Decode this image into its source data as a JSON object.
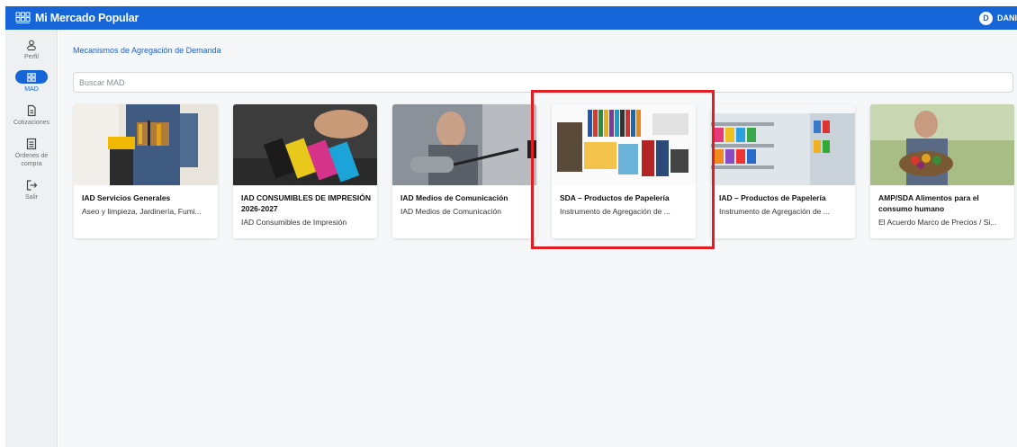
{
  "app": {
    "title": "Mi Mercado Popular"
  },
  "user": {
    "initial": "D",
    "name": "DANI"
  },
  "sidebar": {
    "items": [
      {
        "label": "Perfil",
        "icon": "user-group-icon"
      },
      {
        "label": "MAD",
        "icon": "grid-icon",
        "active": true
      },
      {
        "label": "Cotizaciones",
        "icon": "document-icon"
      },
      {
        "label": "Órdenes de compra",
        "icon": "list-icon"
      },
      {
        "label": "Salir",
        "icon": "logout-icon"
      }
    ]
  },
  "main": {
    "breadcrumb": "Mecanismos de Agregación de Demanda",
    "search_placeholder": "Buscar MAD",
    "cards": [
      {
        "title": "IAD Servicios Generales",
        "description": "Aseo y limpieza, Jardinería, Fumi...",
        "image": "worker-toolbelt-photo"
      },
      {
        "title": "IAD CONSUMIBLES DE IMPRESIÓN 2026-2027",
        "description": "IAD Consumibles de Impresión",
        "image": "ink-cartridges-photo"
      },
      {
        "title": "IAD Medios de Comunicación",
        "description": "IAD Medios de Comunicación",
        "image": "microphone-studio-photo"
      },
      {
        "title": "SDA – Productos de Papelería",
        "description": "Instrumento de Agregación de ...",
        "image": "stationery-supplies-photo"
      },
      {
        "title": "IAD – Productos de Papelería",
        "description": "Instrumento de Agregación de ...",
        "image": "store-shelves-photo"
      },
      {
        "title": "AMP/SDA Alimentos para el consumo humano",
        "description": "El Acuerdo Marco de Precios / Si...",
        "image": "farmer-vegetables-photo"
      }
    ]
  },
  "colors": {
    "brand": "#1565d8",
    "highlight": "#e01e24",
    "background": "#f6f7f8"
  }
}
